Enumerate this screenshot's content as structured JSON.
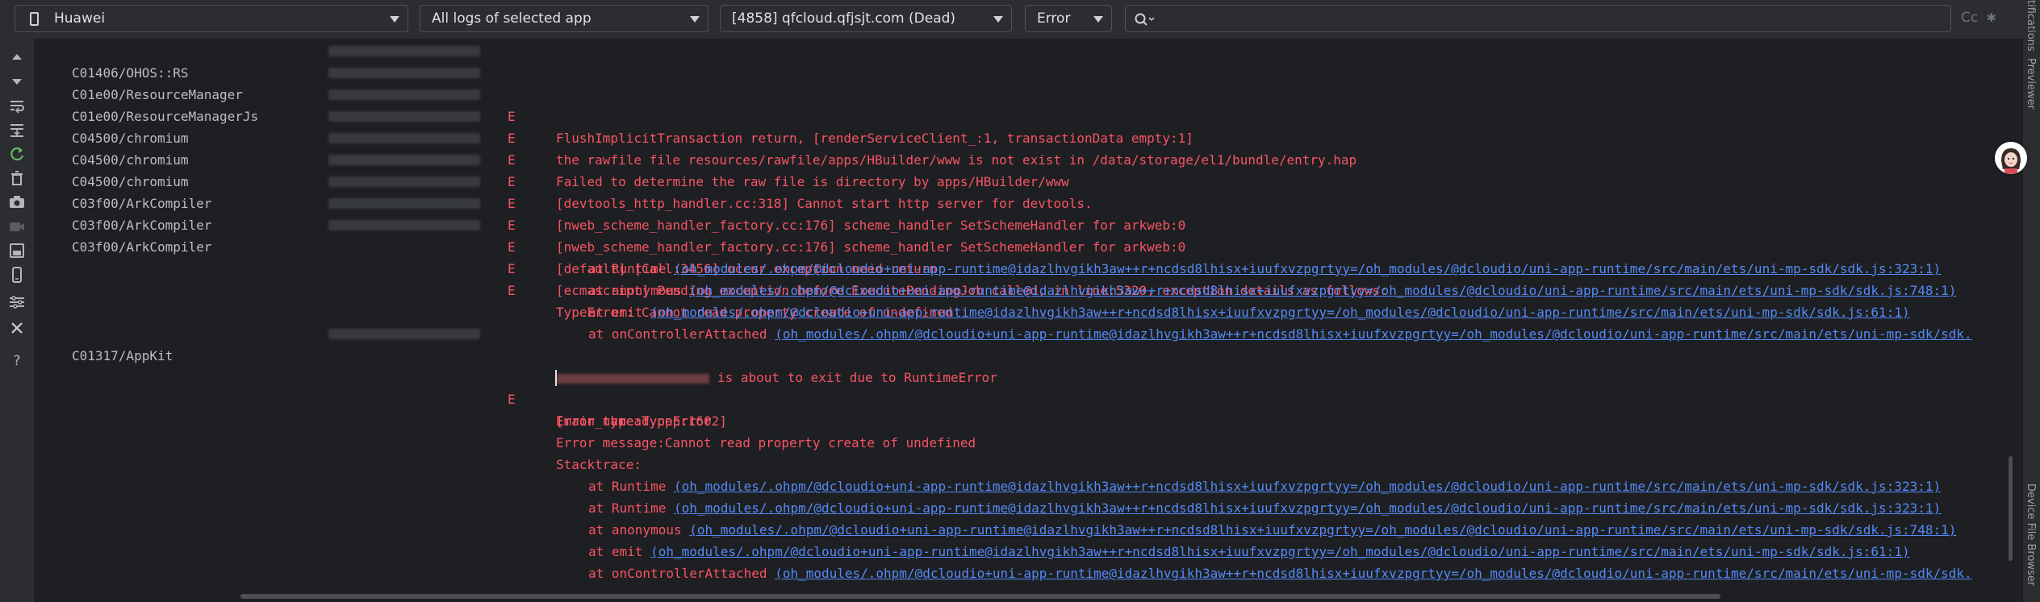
{
  "toolbar": {
    "device": "Huawei",
    "log_scope": "All logs of selected app",
    "process": "[4858] qfcloud.qfjsjt.com (Dead)",
    "level": "Error",
    "search_placeholder": "",
    "case_label": "Cc"
  },
  "side_labels": {
    "notifications": "tifications",
    "previewer": "Previewer",
    "device_file_browser": "Device File Browser"
  },
  "rows": [
    {
      "tag": "C01406/OHOS::RS",
      "level": "E",
      "message": "FlushImplicitTransaction return, [renderServiceClient_:1, transactionData empty:1]"
    },
    {
      "tag": "C01e00/ResourceManager",
      "level": "E",
      "message": "the rawfile file resources/rawfile/apps/HBuilder/www is not exist in /data/storage/el1/bundle/entry.hap"
    },
    {
      "tag": "C01e00/ResourceManagerJs",
      "level": "E",
      "message": "Failed to determine the raw file is directory by apps/HBuilder/www"
    },
    {
      "tag": "C04500/chromium",
      "level": "E",
      "message": "[devtools_http_handler.cc:318] Cannot start http server for devtools."
    },
    {
      "tag": "C04500/chromium",
      "level": "E",
      "message": "[nweb_scheme_handler_factory.cc:176] scheme_handler SetSchemeHandler for arkweb:0"
    },
    {
      "tag": "C04500/chromium",
      "level": "E",
      "message": "[nweb_scheme_handler_factory.cc:176] scheme_handler SetSchemeHandler for arkweb:0"
    },
    {
      "tag": "C03f00/ArkCompiler",
      "level": "E",
      "message": "[default] [Call:3456] occur exception need return"
    },
    {
      "tag": "C03f00/ArkCompiler",
      "level": "E",
      "message": "[ecmascript] Pending exception before ExecutePendingJob called, in line:5320, exception details as follows:"
    },
    {
      "tag": "C03f00/ArkCompiler",
      "level": "E",
      "message": "TypeError: Cannot read property create of undefined"
    }
  ],
  "trace1": [
    {
      "fn": "at Runtime ",
      "path": "(oh_modules/.ohpm/@dcloudio+uni-app-runtime@idazlhvgikh3aw++r+ncdsd8lhisx+iuufxvzpgrtyy=/oh_modules/@dcloudio/uni-app-runtime/src/main/ets/uni-mp-sdk/sdk.js:323:1)"
    },
    {
      "fn": "at anonymous ",
      "path": "(oh_modules/.ohpm/@dcloudio+uni-app-runtime@idazlhvgikh3aw++r+ncdsd8lhisx+iuufxvzpgrtyy=/oh_modules/@dcloudio/uni-app-runtime/src/main/ets/uni-mp-sdk/sdk.js:748:1)"
    },
    {
      "fn": "at emit ",
      "path": "(oh_modules/.ohpm/@dcloudio+uni-app-runtime@idazlhvgikh3aw++r+ncdsd8lhisx+iuufxvzpgrtyy=/oh_modules/@dcloudio/uni-app-runtime/src/main/ets/uni-mp-sdk/sdk.js:61:1)"
    },
    {
      "fn": "at onControllerAttached ",
      "path": "(oh_modules/.ohpm/@dcloudio+uni-app-runtime@idazlhvgikh3aw++r+ncdsd8lhisx+iuufxvzpgrtyy=/oh_modules/@dcloudio/uni-app-runtime/src/main/ets/uni-mp-sdk/sdk."
    }
  ],
  "appkit": {
    "tag": "C01317/AppKit",
    "level": "E",
    "line1": "[main_thread.cpp:1602]",
    "line2": "is about to exit due to RuntimeError",
    "line3": "Error type:TypeError",
    "line4": "Error name:TypeError",
    "line5": "Error message:Cannot read property create of undefined",
    "line6": "Stacktrace:"
  },
  "trace2": [
    {
      "fn": "at Runtime ",
      "path": "(oh_modules/.ohpm/@dcloudio+uni-app-runtime@idazlhvgikh3aw++r+ncdsd8lhisx+iuufxvzpgrtyy=/oh_modules/@dcloudio/uni-app-runtime/src/main/ets/uni-mp-sdk/sdk.js:323:1)"
    },
    {
      "fn": "at Runtime ",
      "path": "(oh_modules/.ohpm/@dcloudio+uni-app-runtime@idazlhvgikh3aw++r+ncdsd8lhisx+iuufxvzpgrtyy=/oh_modules/@dcloudio/uni-app-runtime/src/main/ets/uni-mp-sdk/sdk.js:323:1)"
    },
    {
      "fn": "at anonymous ",
      "path": "(oh_modules/.ohpm/@dcloudio+uni-app-runtime@idazlhvgikh3aw++r+ncdsd8lhisx+iuufxvzpgrtyy=/oh_modules/@dcloudio/uni-app-runtime/src/main/ets/uni-mp-sdk/sdk.js:748:1)"
    },
    {
      "fn": "at emit ",
      "path": "(oh_modules/.ohpm/@dcloudio+uni-app-runtime@idazlhvgikh3aw++r+ncdsd8lhisx+iuufxvzpgrtyy=/oh_modules/@dcloudio/uni-app-runtime/src/main/ets/uni-mp-sdk/sdk.js:61:1)"
    },
    {
      "fn": "at onControllerAttached ",
      "path": "(oh_modules/.ohpm/@dcloudio+uni-app-runtime@idazlhvgikh3aw++r+ncdsd8lhisx+iuufxvzpgrtyy=/oh_modules/@dcloudio/uni-app-runtime/src/main/ets/uni-mp-sdk/sdk."
    }
  ],
  "colors": {
    "error_text": "#f75464",
    "link": "#548af7",
    "tag_text": "#bcbec4",
    "log_bg": "#1e1f22",
    "panel_bg": "#2b2d30"
  }
}
